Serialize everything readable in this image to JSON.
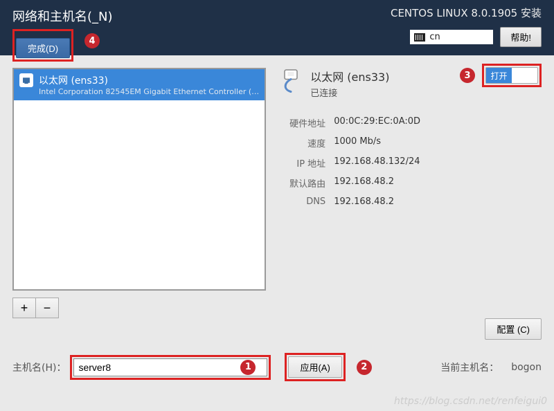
{
  "header": {
    "page_title": "网络和主机名(_N)",
    "done_label": "完成(D)",
    "install_title": "CENTOS LINUX 8.0.1905 安装",
    "lang": "cn",
    "help_label": "帮助!"
  },
  "interfaces": {
    "items": [
      {
        "name": "以太网 (ens33)",
        "subtitle": "Intel Corporation 82545EM Gigabit Ethernet Controller (…"
      }
    ]
  },
  "detail": {
    "title": "以太网 (ens33)",
    "status": "已连接",
    "toggle_on_label": "打开",
    "props": [
      {
        "label": "硬件地址",
        "value": "00:0C:29:EC:0A:0D"
      },
      {
        "label": "速度",
        "value": "1000 Mb/s"
      },
      {
        "label": "IP 地址",
        "value": "192.168.48.132/24"
      },
      {
        "label": "默认路由",
        "value": "192.168.48.2"
      },
      {
        "label": "DNS",
        "value": "192.168.48.2"
      }
    ],
    "configure_label": "配置 (C)"
  },
  "hostname": {
    "label": "主机名(H)：",
    "value": "server8",
    "apply_label": "应用(A)",
    "current_label": "当前主机名：",
    "current_value": "bogon"
  },
  "badges": {
    "b1": "1",
    "b2": "2",
    "b3": "3",
    "b4": "4"
  },
  "watermark": "https://blog.csdn.net/renfeigui0"
}
